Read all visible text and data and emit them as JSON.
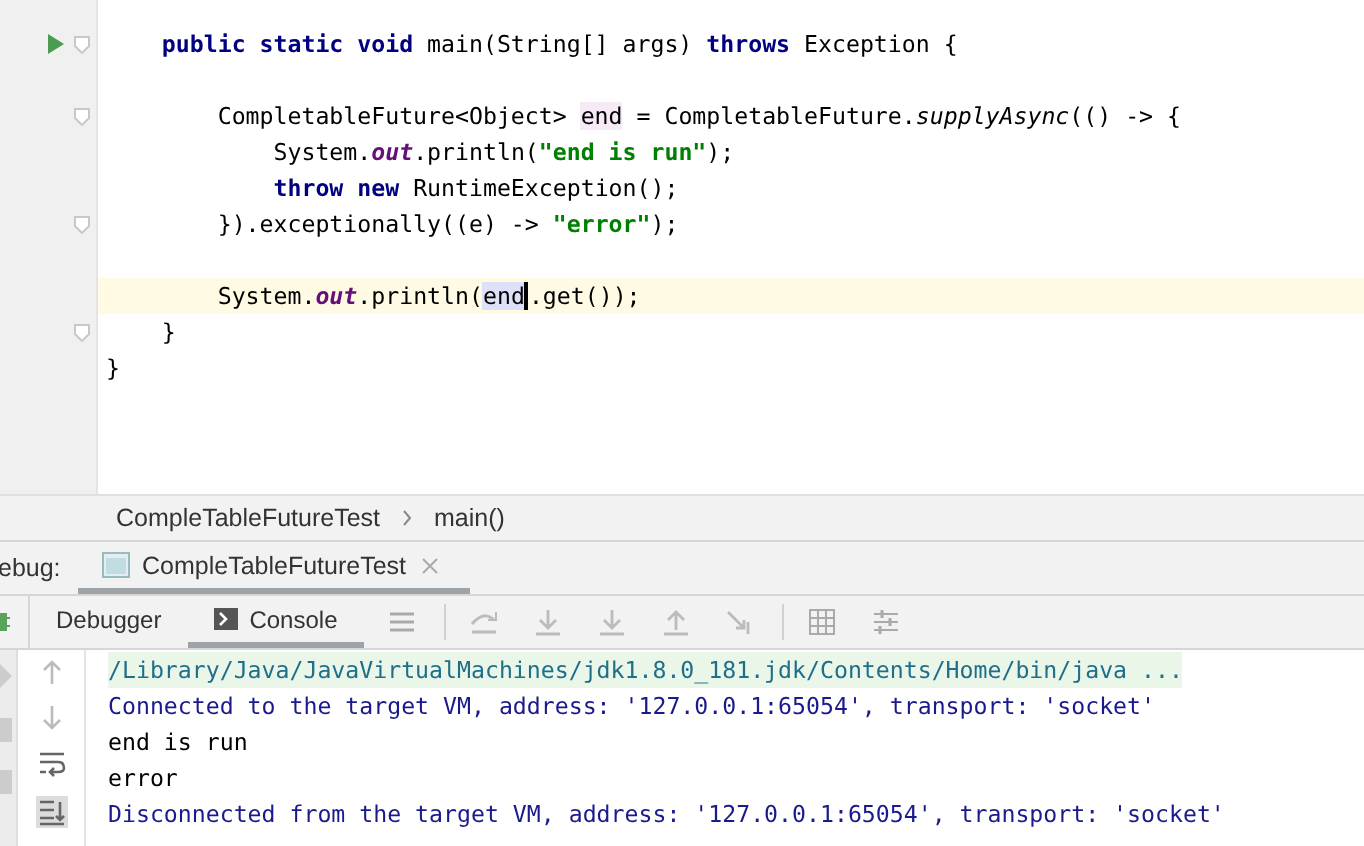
{
  "editor": {
    "lines": [
      {
        "current": false,
        "fold": false,
        "run": false
      },
      {
        "current": false,
        "fold": true,
        "run": true,
        "tokens": [
          {
            "text": "    public static void",
            "kind": "keyword"
          },
          {
            "text": " main(String[] args) "
          },
          {
            "text": "throws",
            "kind": "keyword"
          },
          {
            "text": " Exception {"
          }
        ]
      },
      {
        "current": false,
        "fold": false,
        "run": false
      },
      {
        "current": false,
        "fold": true,
        "run": false,
        "tokens": [
          {
            "text": "        CompletableFuture<Object> "
          },
          {
            "text": "end",
            "kind": "usage"
          },
          {
            "text": " = CompletableFuture."
          },
          {
            "text": "supplyAsync",
            "kind": "static_method"
          },
          {
            "text": "(() -> {"
          }
        ]
      },
      {
        "current": false,
        "fold": false,
        "run": false,
        "tokens": [
          {
            "text": "            System."
          },
          {
            "text": "out",
            "kind": "static_field"
          },
          {
            "text": ".println("
          },
          {
            "text": "\"end is run\"",
            "kind": "string"
          },
          {
            "text": ");"
          }
        ]
      },
      {
        "current": false,
        "fold": false,
        "run": false,
        "tokens": [
          {
            "text": "            throw new",
            "kind": "keyword"
          },
          {
            "text": " RuntimeException();"
          }
        ]
      },
      {
        "current": false,
        "fold": true,
        "run": false,
        "tokens": [
          {
            "text": "        }).exceptionally((e) -> "
          },
          {
            "text": "\"error\"",
            "kind": "string"
          },
          {
            "text": ");"
          }
        ]
      },
      {
        "current": false,
        "fold": false,
        "run": false
      },
      {
        "current": true,
        "fold": false,
        "run": false,
        "tokens": [
          {
            "text": "        System."
          },
          {
            "text": "out",
            "kind": "static_field"
          },
          {
            "text": ".println("
          },
          {
            "text": "end",
            "kind": "caret_usage"
          },
          {
            "text": ".get());"
          }
        ]
      },
      {
        "current": false,
        "fold": true,
        "run": false,
        "tokens": [
          {
            "text": "    }"
          }
        ]
      },
      {
        "current": false,
        "fold": false,
        "run": false,
        "tokens": [
          {
            "text": "}"
          }
        ]
      }
    ]
  },
  "breadcrumb": [
    "CompleTableFutureTest",
    "main()"
  ],
  "debug_bar": {
    "label": "ebug:",
    "tab": {
      "title": "CompleTableFutureTest",
      "closable": true
    }
  },
  "panel_tabs": [
    {
      "label": "Debugger",
      "selected": false
    },
    {
      "label": "Console",
      "selected": true
    }
  ],
  "console": [
    {
      "kind": "command",
      "text": "/Library/Java/JavaVirtualMachines/jdk1.8.0_181.jdk/Contents/Home/bin/java ..."
    },
    {
      "kind": "system",
      "text": "Connected to the target VM, address: '127.0.0.1:65054', transport: 'socket'"
    },
    {
      "kind": "output",
      "text": "end is run"
    },
    {
      "kind": "output",
      "text": "error"
    },
    {
      "kind": "system",
      "text": "Disconnected from the target VM, address: '127.0.0.1:65054', transport: 'socket'"
    }
  ]
}
